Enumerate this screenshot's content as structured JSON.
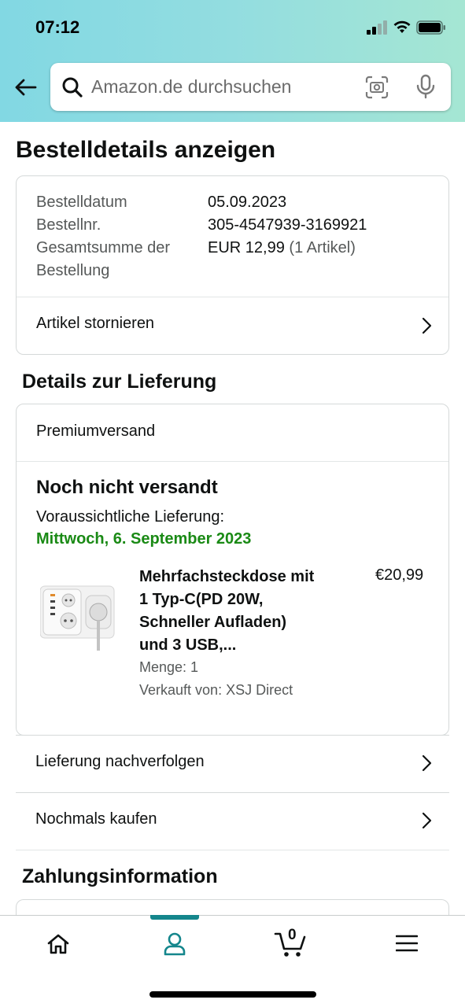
{
  "status_bar": {
    "time": "07:12"
  },
  "search": {
    "placeholder": "Amazon.de durchsuchen"
  },
  "page": {
    "title": "Bestelldetails anzeigen"
  },
  "order_summary": {
    "date_label": "Bestelldatum",
    "date_value": "05.09.2023",
    "number_label": "Bestellnr.",
    "number_value": "305-4547939-3169921",
    "total_label_line1": "Gesamtsumme der",
    "total_label_line2": "Bestellung",
    "total_value": "EUR 12,99",
    "total_count": "(1 Artikel)",
    "cancel_label": "Artikel stornieren"
  },
  "delivery": {
    "section_title": "Details zur Lieferung",
    "shipping_method": "Premiumversand",
    "status": "Noch nicht versandt",
    "expected_label": "Voraussichtliche Lieferung:",
    "expected_date": "Mittwoch, 6. September 2023",
    "expected_date_color": "#1a8a15",
    "item": {
      "title_lines": [
        "Mehrfachsteckdose mit",
        "1 Typ-C(PD 20W,",
        "Schneller Aufladen)",
        "und 3 USB,..."
      ],
      "price": "€20,99",
      "quantity": "Menge: 1",
      "seller": "Verkauft von: XSJ Direct"
    },
    "track_label": "Lieferung nachverfolgen",
    "buy_again_label": "Nochmals kaufen"
  },
  "payment": {
    "section_title": "Zahlungsinformation"
  },
  "bottom_nav": {
    "items": [
      "home-icon",
      "account-icon",
      "cart-icon",
      "menu-icon"
    ],
    "active": "account-icon",
    "cart_count": "0",
    "accent_color": "#14868c"
  }
}
